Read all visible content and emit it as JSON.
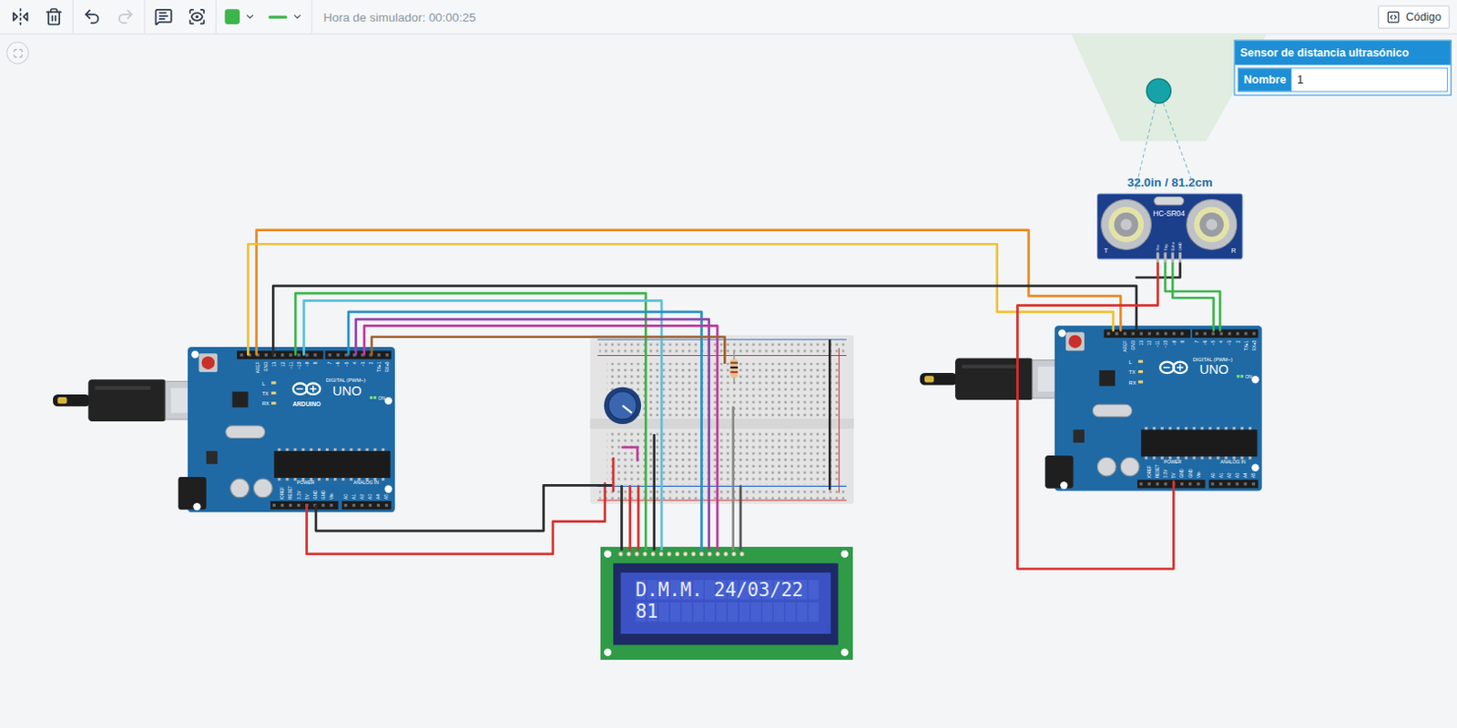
{
  "toolbar": {
    "history": {
      "undo_disabled": false,
      "redo_disabled": true
    },
    "wire_color": "#3cb54a",
    "sim_time": "Hora de simulador: 00:00:25",
    "code_button": "Código"
  },
  "inspector": {
    "title": "Sensor de distancia ultrasónico",
    "fields": [
      {
        "label": "Nombre",
        "value": "1"
      }
    ]
  },
  "sensor": {
    "model": "HC-SR04",
    "reading": "32.0in / 81.2cm",
    "pins": [
      "Vcc",
      "Trig",
      "Echo",
      "GND"
    ],
    "marks": [
      "T",
      "R"
    ]
  },
  "arduinos": [
    {
      "brand": "ARDUINO",
      "model": "UNO",
      "digital_label": "DIGITAL (PWM~)",
      "power_label": "POWER",
      "analog_label": "ANALOG IN",
      "on_label": "ON",
      "leds": [
        "L",
        "TX",
        "RX"
      ],
      "top_pins": [
        "AREF",
        "GND",
        "13",
        "12",
        "~11",
        "~10",
        "~9",
        "8",
        "7",
        "~6",
        "~5",
        "4",
        "~3",
        "2",
        "TX▸1",
        "RX◂0"
      ],
      "power_pins": [
        "IOREF",
        "RESET",
        "3.3V",
        "5V",
        "GND",
        "GND",
        "Vin"
      ],
      "analog_pins": [
        "A0",
        "A1",
        "A2",
        "A3",
        "A4",
        "A5"
      ]
    },
    {
      "model": "UNO",
      "digital_label": "DIGITAL (PWM~)",
      "power_label": "POWER",
      "analog_label": "ANALOG IN",
      "on_label": "ON",
      "leds": [
        "L",
        "TX",
        "RX"
      ],
      "top_pins": [
        "AREF",
        "GND",
        "13",
        "12",
        "~11",
        "~10",
        "~9",
        "8",
        "7",
        "~6",
        "~5",
        "4",
        "~3",
        "2",
        "TX▸1",
        "RX◂0"
      ],
      "power_pins": [
        "IOREF",
        "RESET",
        "3.3V",
        "5V",
        "GND",
        "GND",
        "Vin"
      ],
      "analog_pins": [
        "A0",
        "A1",
        "A2",
        "A3",
        "A4",
        "A5"
      ]
    }
  ],
  "lcd": {
    "lines": [
      "D.M.M. 24/03/22",
      "81"
    ]
  }
}
